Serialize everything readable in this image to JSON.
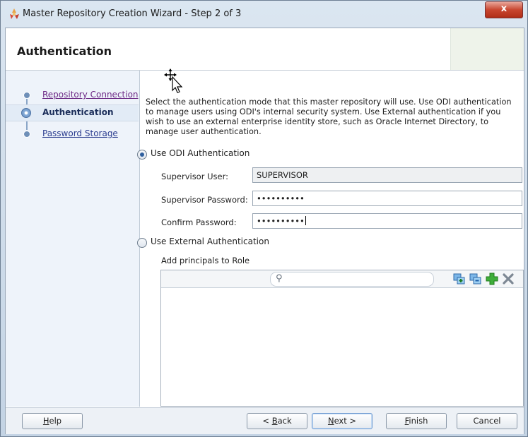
{
  "window": {
    "title": "Master Repository Creation Wizard - Step 2 of 3",
    "close_glyph": "x"
  },
  "header": {
    "title": "Authentication"
  },
  "nav": {
    "items": [
      {
        "label": "Repository Connection",
        "state": "visited"
      },
      {
        "label": "Authentication",
        "state": "active"
      },
      {
        "label": "Password Storage",
        "state": "link"
      }
    ]
  },
  "main": {
    "description": "Select the authentication mode that this master repository will use. Use ODI authentication to manage users using ODI's internal security system. Use External authentication if you wish to use an external enterprise identity store, such as Oracle Internet Directory, to manage user authentication.",
    "odi_auth": {
      "label": "Use ODI Authentication",
      "selected": true,
      "supervisor_user_label": "Supervisor User:",
      "supervisor_user_value": "SUPERVISOR",
      "supervisor_password_label": "Supervisor Password:",
      "supervisor_password_value": "••••••••••",
      "confirm_password_label": "Confirm Password:",
      "confirm_password_value": "••••••••••"
    },
    "external_auth": {
      "label": "Use External Authentication",
      "selected": false,
      "principals_label": "Add principals to Role"
    },
    "principals_table": {
      "search_placeholder": "",
      "toolbar_icons": [
        "add-principal-icon",
        "remove-principal-icon",
        "add-icon",
        "delete-icon"
      ]
    }
  },
  "footer": {
    "help": {
      "label": "Help",
      "mnemonic": "H"
    },
    "back": {
      "label": "< Back",
      "mnemonic": "B"
    },
    "next": {
      "label": "Next >",
      "mnemonic": "N"
    },
    "finish": {
      "label": "Finish",
      "mnemonic": "F"
    },
    "cancel": {
      "label": "Cancel"
    }
  },
  "colors": {
    "accent": "#2a3c8f",
    "visited_link": "#6d2a86",
    "close_button": "#c8462f"
  }
}
